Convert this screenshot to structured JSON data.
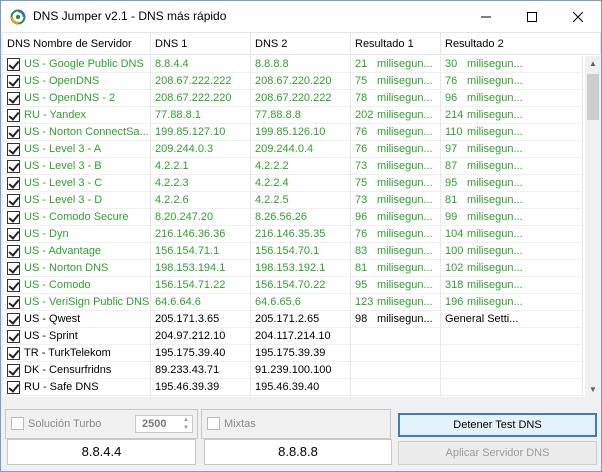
{
  "window": {
    "title": "DNS Jumper v2.1 - DNS más rápido",
    "min_glyph": "—",
    "max_glyph": "☐",
    "close_glyph": "✕"
  },
  "colors": {
    "ok": "#2fa12f",
    "normal": "#000000"
  },
  "columns": [
    "DNS Nombre de Servidor",
    "DNS 1",
    "DNS 2",
    "Resultado 1",
    "Resultado 2"
  ],
  "rows": [
    {
      "checked": true,
      "name": "US - Google Public DNS",
      "dns1": "8.8.4.4",
      "dns2": "8.8.8.8",
      "r1n": "21",
      "r1u": "milisegun...",
      "r2n": "30",
      "r2u": "milisegun...",
      "status": "ok"
    },
    {
      "checked": true,
      "name": "US - OpenDNS",
      "dns1": "208.67.222.222",
      "dns2": "208.67.220.220",
      "r1n": "75",
      "r1u": "milisegun...",
      "r2n": "76",
      "r2u": "milisegun...",
      "status": "ok"
    },
    {
      "checked": true,
      "name": "US - OpenDNS - 2",
      "dns1": "208.67.222.220",
      "dns2": "208.67.220.222",
      "r1n": "78",
      "r1u": "milisegun...",
      "r2n": "96",
      "r2u": "milisegun...",
      "status": "ok"
    },
    {
      "checked": true,
      "name": "RU - Yandex",
      "dns1": "77.88.8.1",
      "dns2": "77.88.8.8",
      "r1n": "202",
      "r1u": "milisegun...",
      "r2n": "214",
      "r2u": "milisegun...",
      "status": "ok"
    },
    {
      "checked": true,
      "name": "US - Norton ConnectSa...",
      "dns1": "199.85.127.10",
      "dns2": "199.85.126.10",
      "r1n": "76",
      "r1u": "milisegun...",
      "r2n": "110",
      "r2u": "milisegun...",
      "status": "ok"
    },
    {
      "checked": true,
      "name": "US - Level 3 - A",
      "dns1": "209.244.0.3",
      "dns2": "209.244.0.4",
      "r1n": "76",
      "r1u": "milisegun...",
      "r2n": "97",
      "r2u": "milisegun...",
      "status": "ok"
    },
    {
      "checked": true,
      "name": "US - Level 3 - B",
      "dns1": "4.2.2.1",
      "dns2": "4.2.2.2",
      "r1n": "73",
      "r1u": "milisegun...",
      "r2n": "87",
      "r2u": "milisegun...",
      "status": "ok"
    },
    {
      "checked": true,
      "name": "US - Level 3 - C",
      "dns1": "4.2.2.3",
      "dns2": "4.2.2.4",
      "r1n": "75",
      "r1u": "milisegun...",
      "r2n": "95",
      "r2u": "milisegun...",
      "status": "ok"
    },
    {
      "checked": true,
      "name": "US - Level 3 - D",
      "dns1": "4.2.2.6",
      "dns2": "4.2.2.5",
      "r1n": "73",
      "r1u": "milisegun...",
      "r2n": "81",
      "r2u": "milisegun...",
      "status": "ok"
    },
    {
      "checked": true,
      "name": "US - Comodo Secure",
      "dns1": "8.20.247.20",
      "dns2": "8.26.56.26",
      "r1n": "96",
      "r1u": "milisegun...",
      "r2n": "99",
      "r2u": "milisegun...",
      "status": "ok"
    },
    {
      "checked": true,
      "name": "US - Dyn",
      "dns1": "216.146.36.36",
      "dns2": "216.146.35.35",
      "r1n": "76",
      "r1u": "milisegun...",
      "r2n": "104",
      "r2u": "milisegun...",
      "status": "ok"
    },
    {
      "checked": true,
      "name": "US - Advantage",
      "dns1": "156.154.71.1",
      "dns2": "156.154.70.1",
      "r1n": "83",
      "r1u": "milisegun...",
      "r2n": "100",
      "r2u": "milisegun...",
      "status": "ok"
    },
    {
      "checked": true,
      "name": "US - Norton DNS",
      "dns1": "198.153.194.1",
      "dns2": "198.153.192.1",
      "r1n": "81",
      "r1u": "milisegun...",
      "r2n": "102",
      "r2u": "milisegun...",
      "status": "ok"
    },
    {
      "checked": true,
      "name": "US - Comodo",
      "dns1": "156.154.71.22",
      "dns2": "156.154.70.22",
      "r1n": "95",
      "r1u": "milisegun...",
      "r2n": "318",
      "r2u": "milisegun...",
      "status": "ok"
    },
    {
      "checked": true,
      "name": "US - VeriSign Public DNS",
      "dns1": "64.6.64.6",
      "dns2": "64.6.65.6",
      "r1n": "123",
      "r1u": "milisegun...",
      "r2n": "196",
      "r2u": "milisegun...",
      "status": "ok"
    },
    {
      "checked": true,
      "name": "US - Qwest",
      "dns1": "205.171.3.65",
      "dns2": "205.171.2.65",
      "r1n": "98",
      "r1u": "milisegun...",
      "r2n": "General Setti...",
      "r2u": "",
      "status": "normal"
    },
    {
      "checked": true,
      "name": "US - Sprint",
      "dns1": "204.97.212.10",
      "dns2": "204.117.214.10",
      "r1n": "",
      "r1u": "",
      "r2n": "",
      "r2u": "",
      "status": "normal"
    },
    {
      "checked": true,
      "name": "TR - TurkTelekom",
      "dns1": "195.175.39.40",
      "dns2": "195.175.39.39",
      "r1n": "",
      "r1u": "",
      "r2n": "",
      "r2u": "",
      "status": "normal"
    },
    {
      "checked": true,
      "name": "DK - Censurfridns",
      "dns1": "89.233.43.71",
      "dns2": "91.239.100.100",
      "r1n": "",
      "r1u": "",
      "r2n": "",
      "r2u": "",
      "status": "normal"
    },
    {
      "checked": true,
      "name": "RU - Safe DNS",
      "dns1": "195.46.39.39",
      "dns2": "195.46.39.40",
      "r1n": "",
      "r1u": "",
      "r2n": "",
      "r2u": "",
      "status": "normal"
    }
  ],
  "bottom": {
    "turbo_label": "Solución Turbo",
    "turbo_value": "2500",
    "mixtas_label": "Mixtas",
    "dns1_value": "8.8.4.4",
    "dns2_value": "8.8.8.8",
    "stop_button": "Detener Test DNS",
    "apply_button": "Aplicar Servidor DNS"
  }
}
